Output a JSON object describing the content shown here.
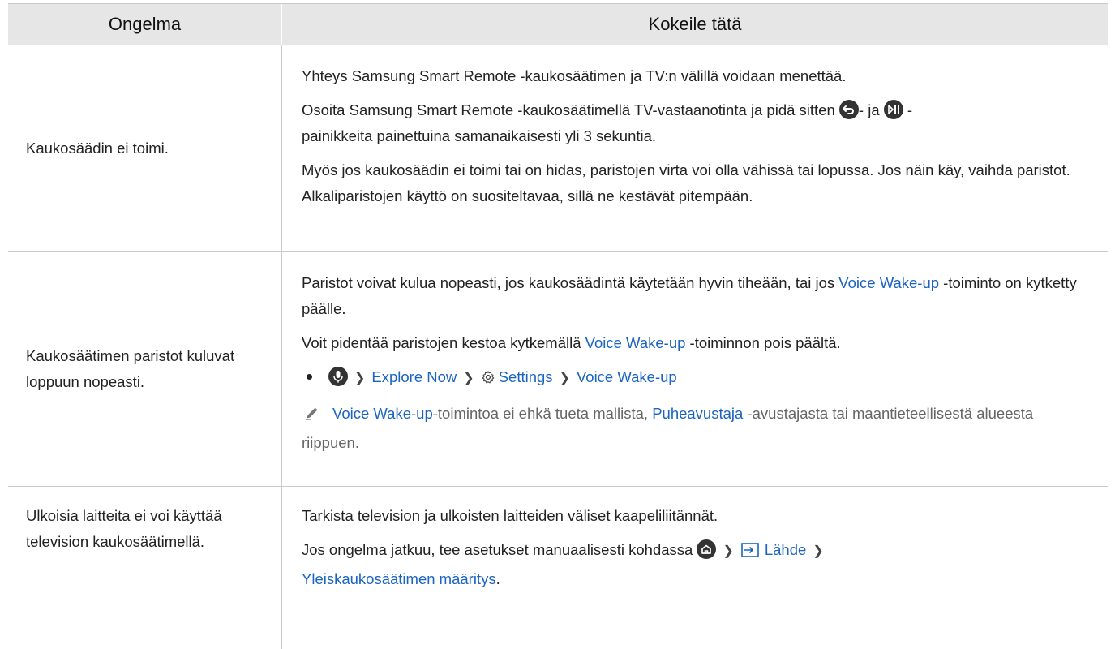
{
  "header": {
    "col1": "Ongelma",
    "col2": "Kokeile tätä"
  },
  "row1": {
    "problem": "Kaukosäädin ei toimi.",
    "p1": "Yhteys Samsung Smart Remote -kaukosäätimen ja TV:n välillä voidaan menettää.",
    "p2_a": "Osoita Samsung Smart Remote -kaukosäätimellä TV-vastaanotinta ja pidä sitten ",
    "p2_b": "- ja ",
    "p2_c": " -",
    "p2_d": "painikkeita painettuina samanaikaisesti yli 3 sekuntia.",
    "p3": "Myös jos kaukosäädin ei toimi tai on hidas, paristojen virta voi olla vähissä tai lopussa. Jos näin käy, vaihda paristot. Alkaliparistojen käyttö on suositeltavaa, sillä ne kestävät pitempään."
  },
  "row2": {
    "problem": "Kaukosäätimen paristot kuluvat loppuun nopeasti.",
    "p1_a": "Paristot voivat kulua nopeasti, jos kaukosäädintä käytetään hyvin tiheään, tai jos ",
    "p1_link": "Voice Wake-up",
    "p1_b": " -toiminto on kytketty päälle.",
    "p2_a": "Voit pidentää paristojen kestoa kytkemällä ",
    "p2_link": "Voice Wake-up",
    "p2_b": " -toiminnon pois päältä.",
    "path_explore": "Explore Now",
    "path_settings": "Settings",
    "path_voice": "Voice Wake-up",
    "note_link1": "Voice Wake-up",
    "note_a": "-toimintoa ei ehkä tueta mallista, ",
    "note_link2": "Puheavustaja",
    "note_b": " -avustajasta tai maantieteellisestä alueesta riippuen."
  },
  "row3": {
    "problem": "Ulkoisia laitteita ei voi käyttää television kaukosäätimellä.",
    "p1": "Tarkista television ja ulkoisten laitteiden väliset kaapeliliitännät.",
    "p2_a": "Jos ongelma jatkuu, tee asetukset manuaalisesti kohdassa ",
    "p2_source": "Lähde",
    "p2_link": "Yleiskaukosäätimen määritys",
    "p2_end": "."
  },
  "colors": {
    "link": "#1b64c0",
    "header_bg": "#e6e6e6",
    "border": "#c9c9c9"
  },
  "icons": [
    "back-button-icon",
    "play-pause-button-icon",
    "microphone-icon",
    "gear-icon",
    "pencil-note-icon",
    "home-icon",
    "source-icon",
    "chevron-right-icon"
  ]
}
